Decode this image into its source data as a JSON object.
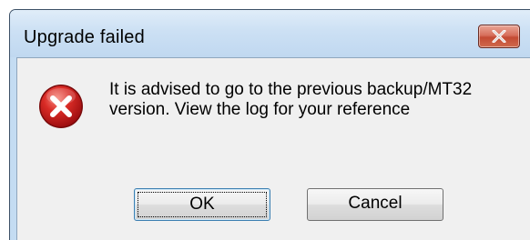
{
  "window": {
    "title": "Upgrade failed",
    "close_icon": "close-icon"
  },
  "message": {
    "icon": "error-icon",
    "icon_color": "#c4161c",
    "text": "It is advised to go to the previous backup/MT32 version. View the log for your reference"
  },
  "buttons": {
    "ok_label": "OK",
    "cancel_label": "Cancel"
  }
}
